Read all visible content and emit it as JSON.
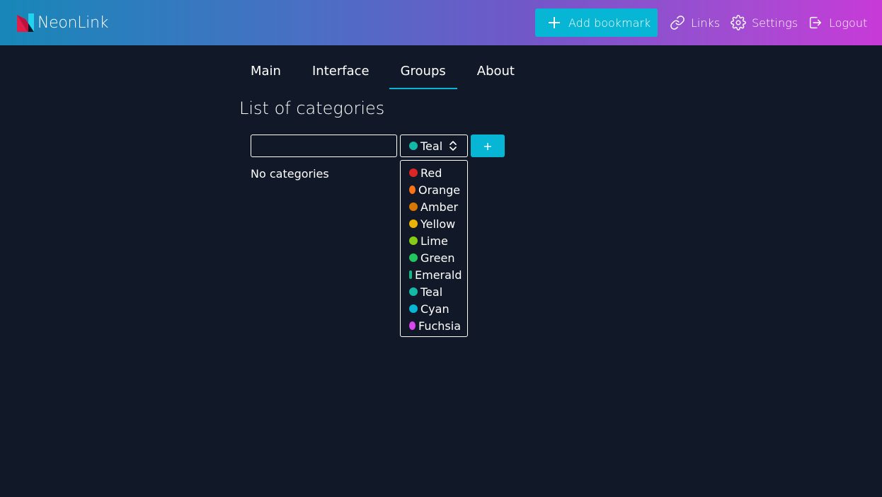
{
  "app": {
    "title": "NeonLink"
  },
  "header": {
    "add_bookmark": "Add bookmark",
    "links": "Links",
    "settings": "Settings",
    "logout": "Logout"
  },
  "tabs": [
    {
      "label": "Main"
    },
    {
      "label": "Interface"
    },
    {
      "label": "Groups",
      "active": true
    },
    {
      "label": "About"
    }
  ],
  "section": {
    "title": "List of categories",
    "input_value": "",
    "selected_color": "Teal",
    "add_button": "+",
    "empty_message": "No categories"
  },
  "color_options": [
    {
      "label": "Red",
      "color": "#dc2626"
    },
    {
      "label": "Orange",
      "color": "#f97316"
    },
    {
      "label": "Amber",
      "color": "#d97706"
    },
    {
      "label": "Yellow",
      "color": "#eab308"
    },
    {
      "label": "Lime",
      "color": "#84cc16"
    },
    {
      "label": "Green",
      "color": "#22c55e"
    },
    {
      "label": "Emerald",
      "color": "#10b981"
    },
    {
      "label": "Teal",
      "color": "#14b8a6"
    },
    {
      "label": "Cyan",
      "color": "#06b6d4"
    },
    {
      "label": "Fuchsia",
      "color": "#d946ef"
    }
  ],
  "colors": {
    "accent": "#06b6d4",
    "background": "#111827"
  }
}
